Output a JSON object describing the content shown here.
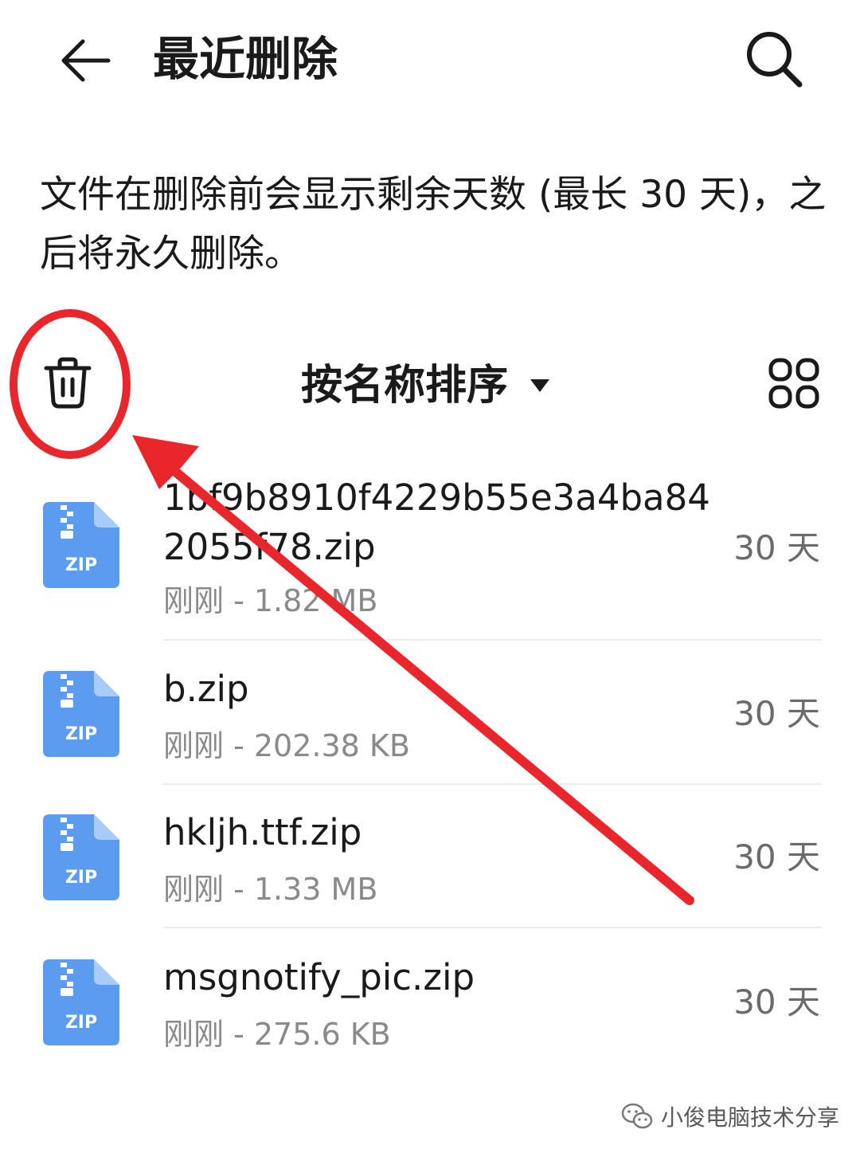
{
  "header": {
    "title": "最近删除",
    "back_icon": "arrow-left-icon",
    "search_icon": "search-icon"
  },
  "info": {
    "text": "文件在删除前会显示剩余天数 (最长 30 天)，之后将永久删除。"
  },
  "toolbar": {
    "delete_icon": "trash-icon",
    "sort_label": "按名称排序",
    "sort_caret_icon": "caret-down-icon",
    "view_icon": "grid-view-icon"
  },
  "files": [
    {
      "name": "1bf9b8910f4229b55e3a4ba842055f78.zip",
      "meta": "刚刚 - 1.82 MB",
      "days": "30 天",
      "icon": "zip-file-icon"
    },
    {
      "name": "b.zip",
      "meta": "刚刚 - 202.38 KB",
      "days": "30 天",
      "icon": "zip-file-icon"
    },
    {
      "name": "hkljh.ttf.zip",
      "meta": "刚刚 - 1.33 MB",
      "days": "30 天",
      "icon": "zip-file-icon"
    },
    {
      "name": "msgnotify_pic.zip",
      "meta": "刚刚 - 275.6 KB",
      "days": "30 天",
      "icon": "zip-file-icon"
    }
  ],
  "zip_icon_label": "ZIP",
  "annotation": {
    "color": "#e8262b"
  },
  "watermark": {
    "text": "小俊电脑技术分享",
    "icon": "wechat-icon"
  },
  "colors": {
    "zip_icon": "#5b9bf0",
    "zip_icon_fold": "#a9cbf7",
    "text_primary": "#1a1a1a",
    "text_secondary": "#8a8a8a",
    "days_text": "#6b6b6b"
  }
}
